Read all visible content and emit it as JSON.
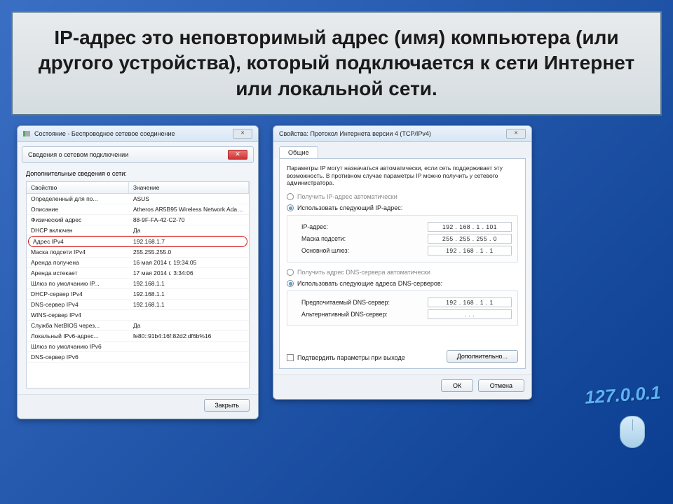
{
  "title_text": "IP-адрес это неповторимый адрес (имя) компьютера (или другого устройства), который подключается к сети Интернет или локальной сети.",
  "decor_ip": "127.0.0.1",
  "left": {
    "win_title": "Состояние - Беспроводное сетевое соединение",
    "sub_title": "Сведения о сетевом подключении",
    "details_label": "Дополнительные сведения о сети:",
    "col_property": "Свойство",
    "col_value": "Значение",
    "rows": [
      {
        "p": "Определенный для по...",
        "v": "ASUS"
      },
      {
        "p": "Описание",
        "v": "Atheros AR5B95 Wireless Network Adapt…"
      },
      {
        "p": "Физический адрес",
        "v": "88-9F-FA-42-C2-70"
      },
      {
        "p": "DHCP включен",
        "v": "Да"
      },
      {
        "p": "Адрес IPv4",
        "v": "192.168.1.7"
      },
      {
        "p": "Маска подсети IPv4",
        "v": "255.255.255.0"
      },
      {
        "p": "Аренда получена",
        "v": "16 мая 2014 г. 19:34:05"
      },
      {
        "p": "Аренда истекает",
        "v": "17 мая 2014 г. 3:34:06"
      },
      {
        "p": "Шлюз по умолчанию IP...",
        "v": "192.168.1.1"
      },
      {
        "p": "DHCP-сервер IPv4",
        "v": "192.168.1.1"
      },
      {
        "p": "DNS-сервер IPv4",
        "v": "192.168.1.1"
      },
      {
        "p": "WINS-сервер IPv4",
        "v": ""
      },
      {
        "p": "Служба NetBIOS через...",
        "v": "Да"
      },
      {
        "p": "Локальный IPv6-адрес...",
        "v": "fe80::91b4:16f:82d2:df6b%16"
      },
      {
        "p": "Шлюз по умолчанию IPv6",
        "v": ""
      },
      {
        "p": "DNS-сервер IPv6",
        "v": ""
      }
    ],
    "close_btn": "Закрыть"
  },
  "right": {
    "win_title": "Свойства: Протокол Интернета версии 4 (TCP/IPv4)",
    "tab": "Общие",
    "desc": "Параметры IP могут назначаться автоматически, если сеть поддерживает эту возможность. В противном случае параметры IP можно получить у сетевого администратора.",
    "r_auto_ip": "Получить IP-адрес автоматически",
    "r_manual_ip": "Использовать следующий IP-адрес:",
    "f_ip": "IP-адрес:",
    "f_mask": "Маска подсети:",
    "f_gw": "Основной шлюз:",
    "v_ip": "192 . 168 .  1  . 101",
    "v_mask": "255 . 255 . 255 .  0",
    "v_gw": "192 . 168 .  1  .  1",
    "r_auto_dns": "Получить адрес DNS-сервера автоматически",
    "r_manual_dns": "Использовать следующие адреса DNS-серверов:",
    "f_dns1": "Предпочитаемый DNS-сервер:",
    "f_dns2": "Альтернативный DNS-сервер:",
    "v_dns1": "192 . 168 .  1  .  1",
    "v_dns2": ".        .        .",
    "check_confirm": "Подтвердить параметры при выходе",
    "btn_adv": "Дополнительно...",
    "btn_ok": "ОК",
    "btn_cancel": "Отмена"
  }
}
